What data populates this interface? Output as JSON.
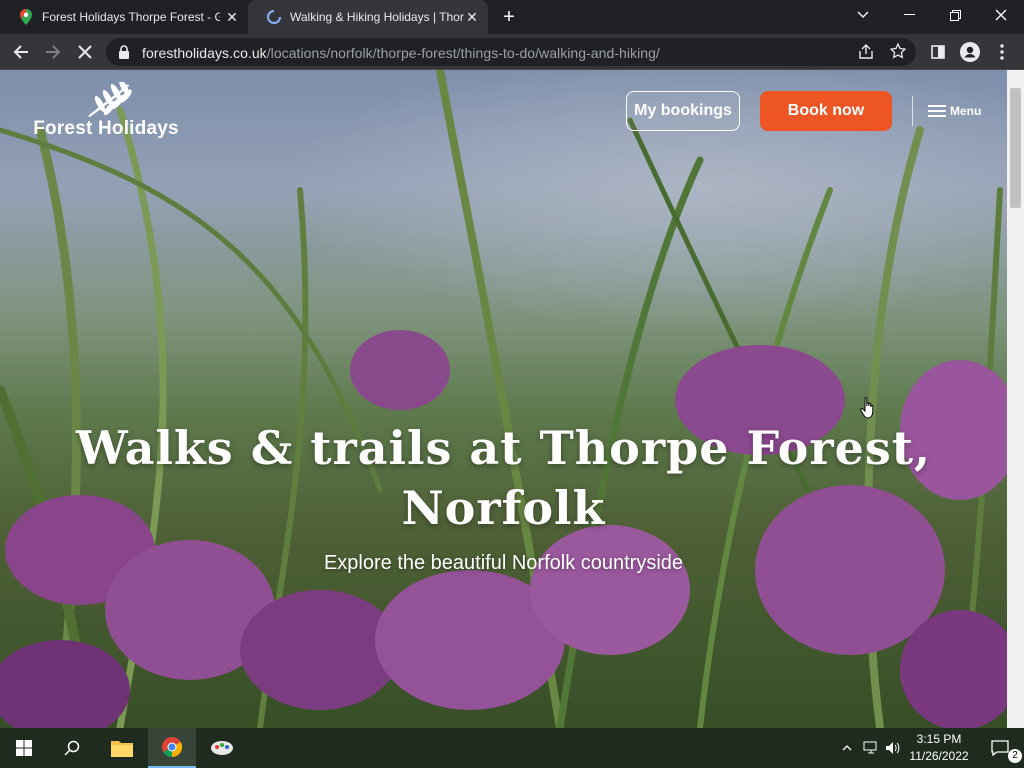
{
  "browser": {
    "tabs": [
      {
        "title": "Forest Holidays Thorpe Forest - G",
        "active": false
      },
      {
        "title": "Walking & Hiking Holidays | Thor",
        "active": true
      }
    ],
    "address": {
      "host": "forestholidays.co.uk",
      "path": "/locations/norfolk/thorpe-forest/things-to-do/walking-and-hiking/"
    }
  },
  "site": {
    "logo_text": "Forest Holidays",
    "nav": {
      "bookings_label": "My bookings",
      "book_label": "Book now",
      "menu_label": "Menu"
    },
    "hero": {
      "title_line1": "Walks & trails at Thorpe Forest,",
      "title_line2": "Norfolk",
      "subtitle": "Explore the beautiful Norfolk countryside"
    }
  },
  "taskbar": {
    "time": "3:15 PM",
    "date": "11/26/2022",
    "notifications": "2"
  },
  "colors": {
    "book_button": "#ed5524",
    "browser_bg": "#202124",
    "toolbar_bg": "#35363a"
  },
  "icons": [
    "chrome-icon",
    "file-explorer-icon",
    "search-icon",
    "windows-start-icon",
    "menu-icon",
    "lock-icon",
    "star-icon",
    "share-icon",
    "profile-icon"
  ]
}
